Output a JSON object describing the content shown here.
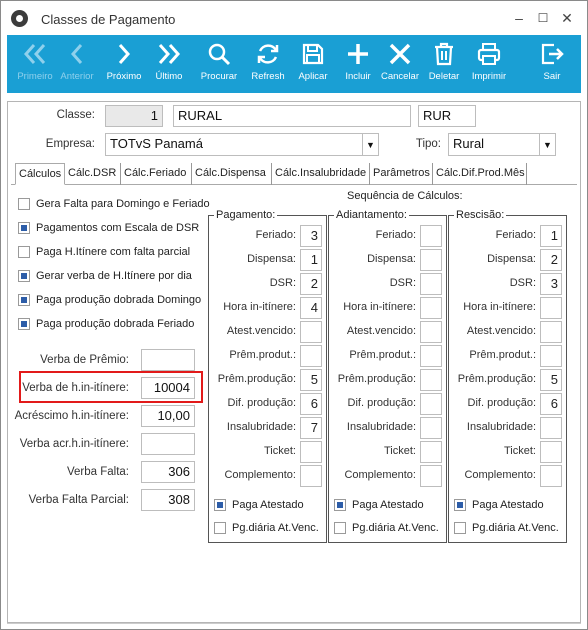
{
  "window": {
    "title": "Classes de Pagamento",
    "minimize_icon": "minimize-icon",
    "maximize_icon": "maximize-icon",
    "close_icon": "close-icon"
  },
  "toolbar": {
    "color": "#1a9fd4",
    "buttons": [
      {
        "label": "Primeiro",
        "icon": "double-chevron-left-icon",
        "disabled": true
      },
      {
        "label": "Anterior",
        "icon": "chevron-left-icon",
        "disabled": true
      },
      {
        "label": "Próximo",
        "icon": "chevron-right-icon",
        "disabled": false
      },
      {
        "label": "Último",
        "icon": "double-chevron-right-icon",
        "disabled": false
      },
      {
        "label": "Procurar",
        "icon": "search-icon",
        "disabled": false
      },
      {
        "label": "Refresh",
        "icon": "refresh-icon",
        "disabled": false
      },
      {
        "label": "Aplicar",
        "icon": "save-icon",
        "disabled": false
      },
      {
        "label": "Incluir",
        "icon": "plus-icon",
        "disabled": false
      },
      {
        "label": "Cancelar",
        "icon": "x-icon",
        "disabled": false
      },
      {
        "label": "Deletar",
        "icon": "trash-icon",
        "disabled": false
      },
      {
        "label": "Imprimir",
        "icon": "printer-icon",
        "disabled": false
      },
      {
        "label": "Sair",
        "icon": "exit-icon",
        "disabled": false
      }
    ]
  },
  "header": {
    "classe_label": "Classe:",
    "classe_code": "1",
    "classe_name": "RURAL",
    "classe_abbr": "RUR",
    "empresa_label": "Empresa:",
    "empresa_value": "TOTvS Panamá",
    "tipo_label": "Tipo:",
    "tipo_value": "Rural"
  },
  "tabs": [
    "Cálculos",
    "Cálc.DSR",
    "Cálc.Feriado",
    "Cálc.Dispensa",
    "Cálc.Insalubridade",
    "Parâmetros",
    "Cálc.Dif.Prod.Mês"
  ],
  "active_tab": "Cálculos",
  "left_checks": [
    {
      "label": "Gera Falta para Domingo e Feriado",
      "checked": false
    },
    {
      "label": "Pagamentos com Escala de DSR",
      "checked": true
    },
    {
      "label": "Paga H.Itínere com falta parcial",
      "checked": false
    },
    {
      "label": "Gerar verba de H.Itínere por dia",
      "checked": true
    },
    {
      "label": "Paga produção dobrada Domingo",
      "checked": true
    },
    {
      "label": "Paga produção dobrada Feriado",
      "checked": true
    }
  ],
  "verbas": [
    {
      "label": "Verba de Prêmio:",
      "value": ""
    },
    {
      "label": "Verba de h.in-itínere:",
      "value": "10004"
    },
    {
      "label": "Acréscimo h.in-itínere:",
      "value": "10,00"
    },
    {
      "label": "Verba acr.h.in-itínere:",
      "value": ""
    },
    {
      "label": "Verba Falta:",
      "value": "306"
    },
    {
      "label": "Verba Falta Parcial:",
      "value": "308"
    }
  ],
  "sequencia": {
    "title": "Sequência de Cálculos:",
    "row_labels": [
      "Feriado:",
      "Dispensa:",
      "DSR:",
      "Hora in-itínere:",
      "Atest.vencido:",
      "Prêm.produt.:",
      "Prêm.produção:",
      "Dif. produção:",
      "Insalubridade:",
      "Ticket:",
      "Complemento:"
    ],
    "groups": [
      {
        "title": "Pagamento:",
        "values": [
          "3",
          "1",
          "2",
          "4",
          "",
          "",
          "5",
          "6",
          "7",
          "",
          ""
        ],
        "paga_atestado": true,
        "pg_diaria": false
      },
      {
        "title": "Adiantamento:",
        "values": [
          "",
          "",
          "",
          "",
          "",
          "",
          "",
          "",
          "",
          "",
          ""
        ],
        "paga_atestado": true,
        "pg_diaria": false
      },
      {
        "title": "Rescisão:",
        "values": [
          "1",
          "2",
          "3",
          "",
          "",
          "",
          "5",
          "6",
          "",
          "",
          ""
        ],
        "paga_atestado": true,
        "pg_diaria": false
      }
    ],
    "paga_atestado_label": "Paga Atestado",
    "pg_diaria_label": "Pg.diária At.Venc."
  }
}
